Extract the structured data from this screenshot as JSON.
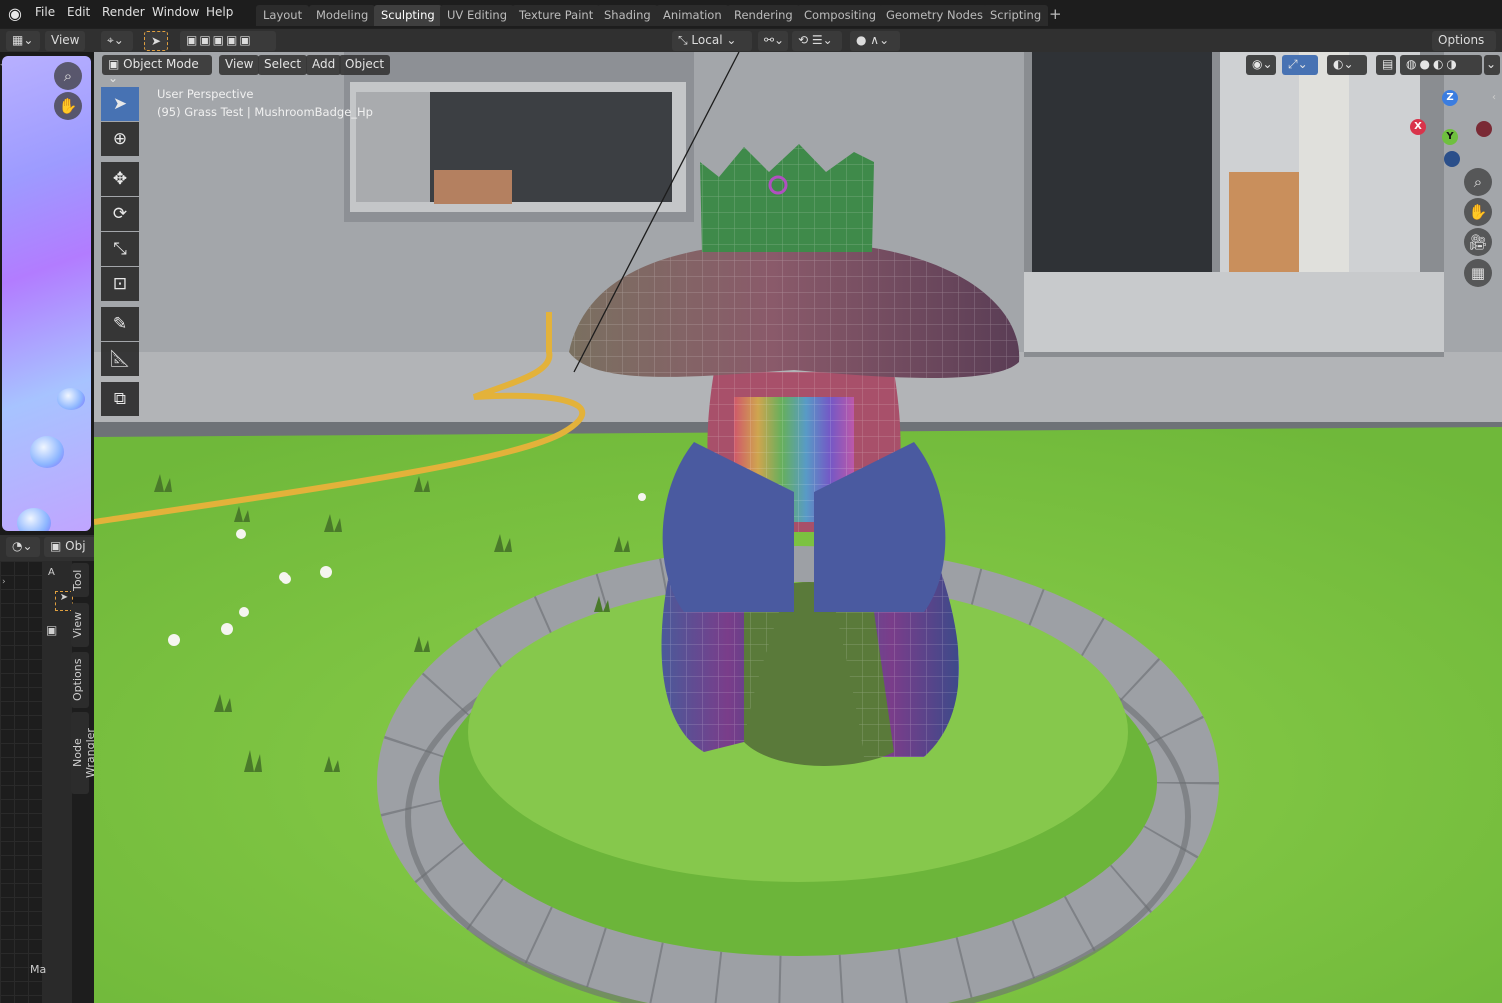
{
  "topbar": {
    "menus": [
      "File",
      "Edit",
      "Render",
      "Window",
      "Help"
    ],
    "workspaces": [
      "Layout",
      "Modeling",
      "Sculpting",
      "UV Editing",
      "Texture Paint",
      "Shading",
      "Animation",
      "Rendering",
      "Compositing",
      "Geometry Nodes",
      "Scripting"
    ],
    "active_workspace": "Sculpting",
    "add_tab": "+"
  },
  "toolheader": {
    "left_view": "View",
    "orientation": "Local",
    "options": "Options"
  },
  "viewport": {
    "mode": "Object Mode",
    "menus": [
      "View",
      "Select",
      "Add",
      "Object"
    ],
    "perspective": "User Perspective",
    "object_info": "(95) Grass Test | MushroomBadge_Hp",
    "gizmo": {
      "z": "Z",
      "y": "Y",
      "x": "X"
    }
  },
  "leftpanel": {
    "object_short": "Obj",
    "tabs": [
      "Tool",
      "View",
      "Options",
      "Node Wrangler"
    ],
    "a_label": "A",
    "bottom_label": "Ma"
  },
  "colors": {
    "accent": "#4772b3",
    "grass": "#7bc043",
    "stone": "#8f9296",
    "wall": "#a7a9ad"
  },
  "icons": [
    "blender-logo-icon",
    "select-box-icon",
    "cursor-icon",
    "move-icon",
    "rotate-icon",
    "scale-icon",
    "transform-icon",
    "annotate-icon",
    "measure-icon",
    "add-cube-icon",
    "zoom-icon",
    "hand-icon",
    "camera-icon",
    "grid-icon"
  ]
}
